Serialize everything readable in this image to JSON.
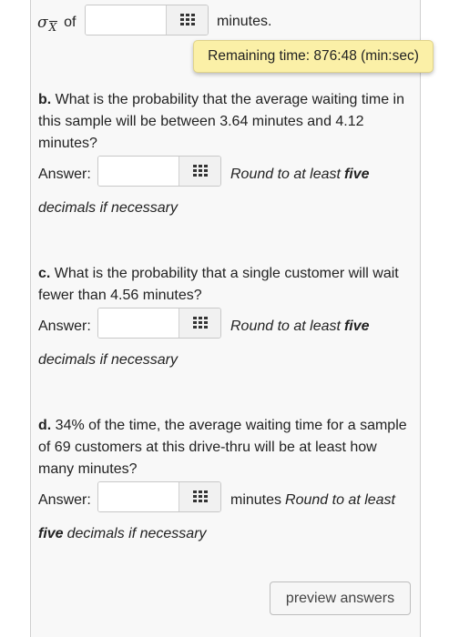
{
  "partA": {
    "sigma_symbol": "σ",
    "sigma_sub": "X",
    "of_text": "of",
    "units": "minutes."
  },
  "timer": {
    "text": "Remaining time: 876:48 (min:sec)"
  },
  "partB": {
    "letter": "b.",
    "question": "What is the probability that the average waiting time in this sample will be between 3.64 minutes and 4.12 minutes?",
    "answer_label": "Answer:",
    "round_text": "Round to at least",
    "round_bold": "five",
    "decimals_text": "decimals if necessary"
  },
  "partC": {
    "letter": "c.",
    "question": "What is the probability that a single customer will wait fewer than 4.56 minutes?",
    "answer_label": "Answer:",
    "round_text": "Round to at least",
    "round_bold": "five",
    "decimals_text": "decimals if necessary"
  },
  "partD": {
    "letter": "d.",
    "question": "34% of the time, the average waiting time for a sample of 69 customers at this drive-thru will be at least how many minutes?",
    "answer_label": "Answer:",
    "units": "minutes",
    "round_text": "Round to at least",
    "round_bold": "five",
    "decimals_text": "decimals if necessary"
  },
  "buttons": {
    "preview": "preview answers"
  },
  "icons": {
    "keypad": "keypad-icon"
  },
  "colors": {
    "timer_bg": "#fbf0a7",
    "panel_bg": "#f8f8f8"
  }
}
